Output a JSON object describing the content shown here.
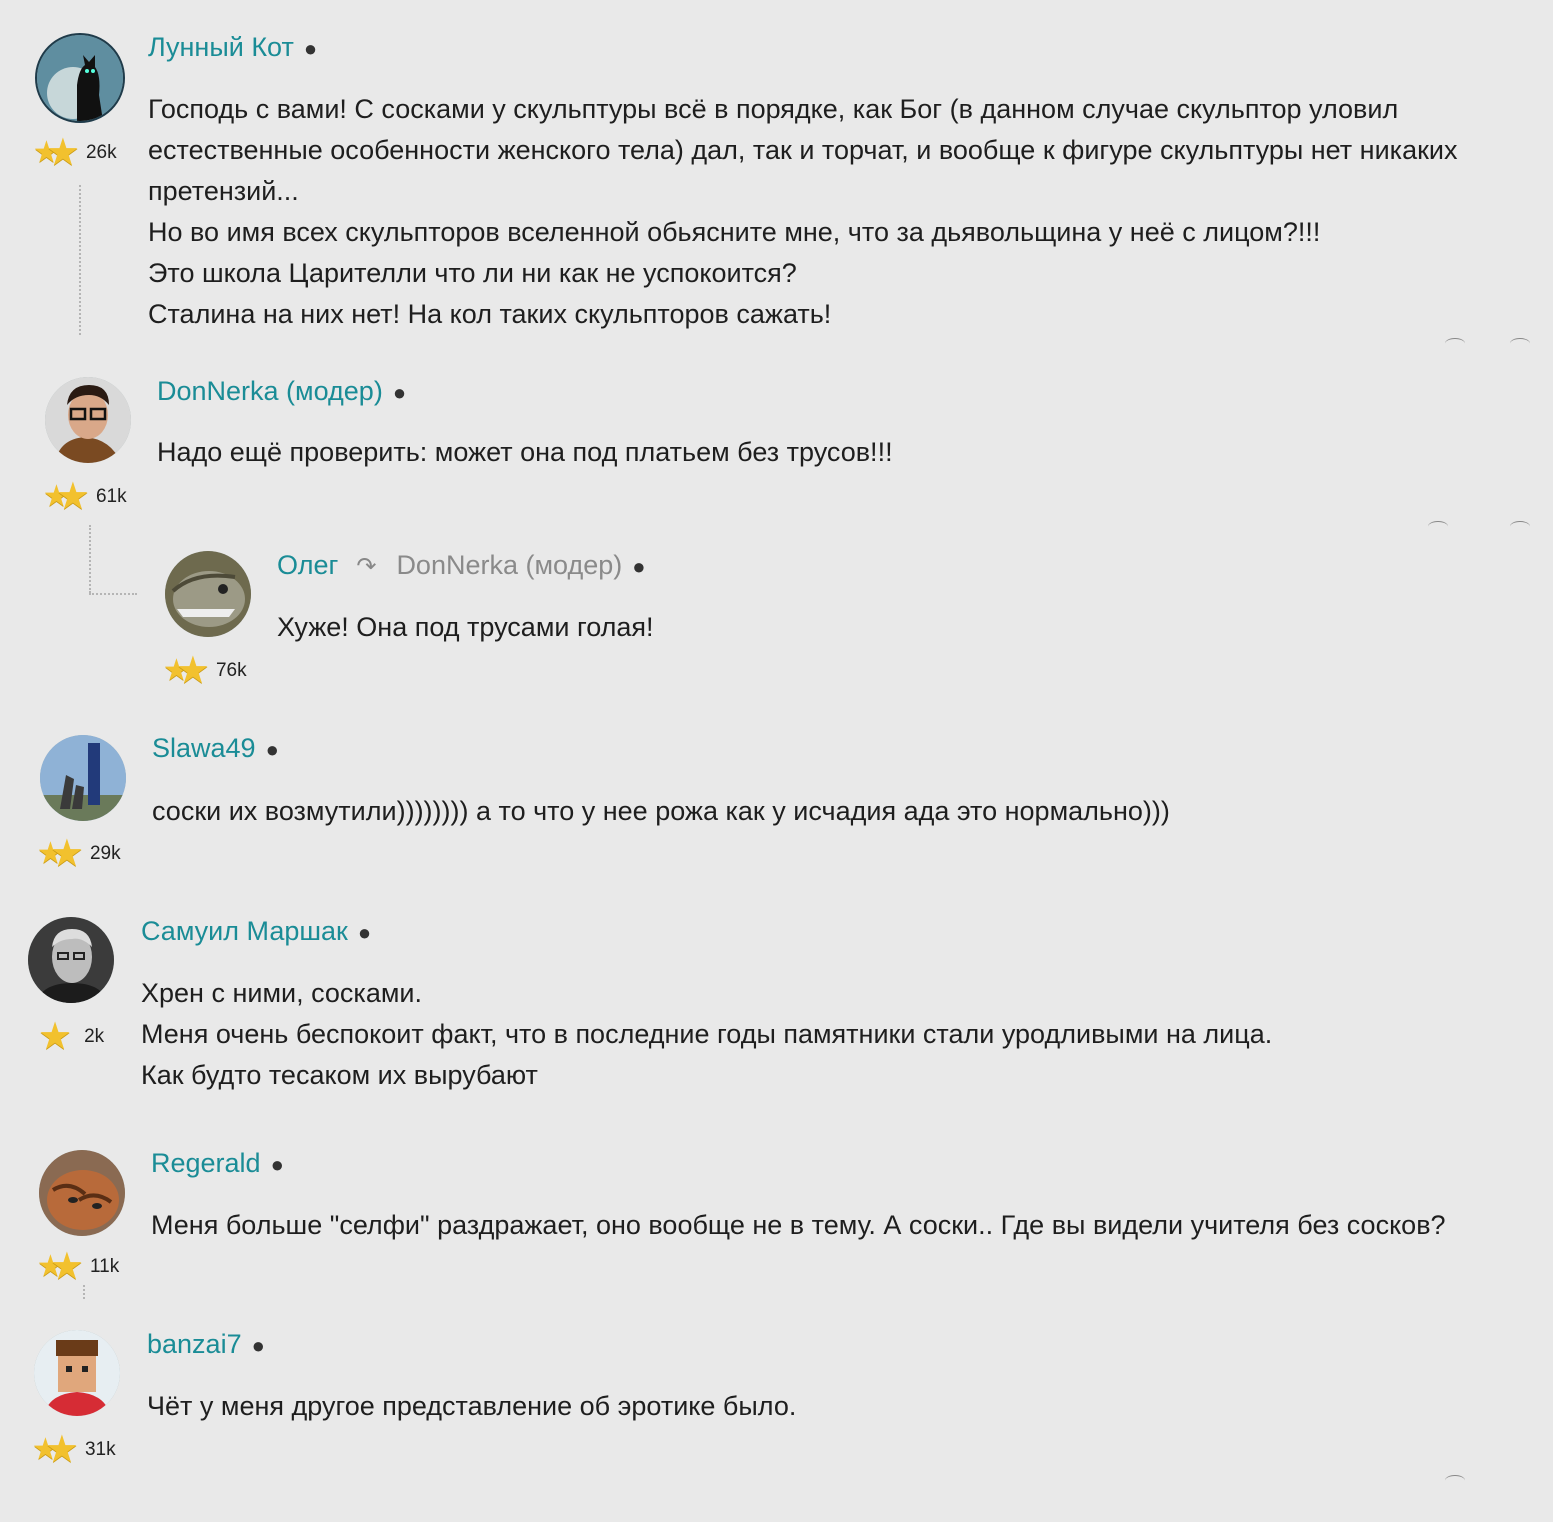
{
  "comments": [
    {
      "author": "Лунный Кот",
      "rating": "26k",
      "text": "Господь с вами! С сосками у скульптуры всё в порядке, как Бог (в данном случае скульптор уловил\nестественные особенности женского тела) дал, так и торчат, и вообще к фигуре скульптуры нет никаких\nпретензий...\nНо во имя всех скульпторов вселенной обьясните мне, что за дьявольщина у неё с лицом?!!!\nЭто школа Царителли что ли ни как не успокоится?\nСталина на них нет! На кол таких скульпторов сажать!"
    },
    {
      "author": "DonNerka (модер)",
      "rating": "61k",
      "text": "Надо ещё проверить: может она под платьем без трусов!!!"
    },
    {
      "author": "Олег",
      "reply_to": "DonNerka (модер)",
      "rating": "76k",
      "text": "Хуже! Она под трусами голая!"
    },
    {
      "author": "Slawa49",
      "rating": "29k",
      "text": "соски их возмутили)))))))) а то что у нее рожа как у исчадия ада это нормально)))"
    },
    {
      "author": "Самуил Маршак",
      "rating": "2k",
      "text": "Хрен с ними, сосками.\nМеня очень беспокоит факт, что в последние годы памятники стали уродливыми на лица.\nКак будто тесаком их вырубают"
    },
    {
      "author": "Regerald",
      "rating": "11k",
      "text": "Меня больше \"селфи\" раздражает, оно вообще не в тему. А соски.. Где вы видели учителя без сосков?"
    },
    {
      "author": "banzai7",
      "rating": "31k",
      "text": "Чёт у меня другое представление об эротике было."
    }
  ],
  "icons": {
    "star": "star-icon",
    "reply": "reply-arrow-icon"
  },
  "colors": {
    "background": "#e9e9e9",
    "author": "#1a8c96",
    "reply_target": "#8a8a8a",
    "star": "#f2c12e"
  }
}
